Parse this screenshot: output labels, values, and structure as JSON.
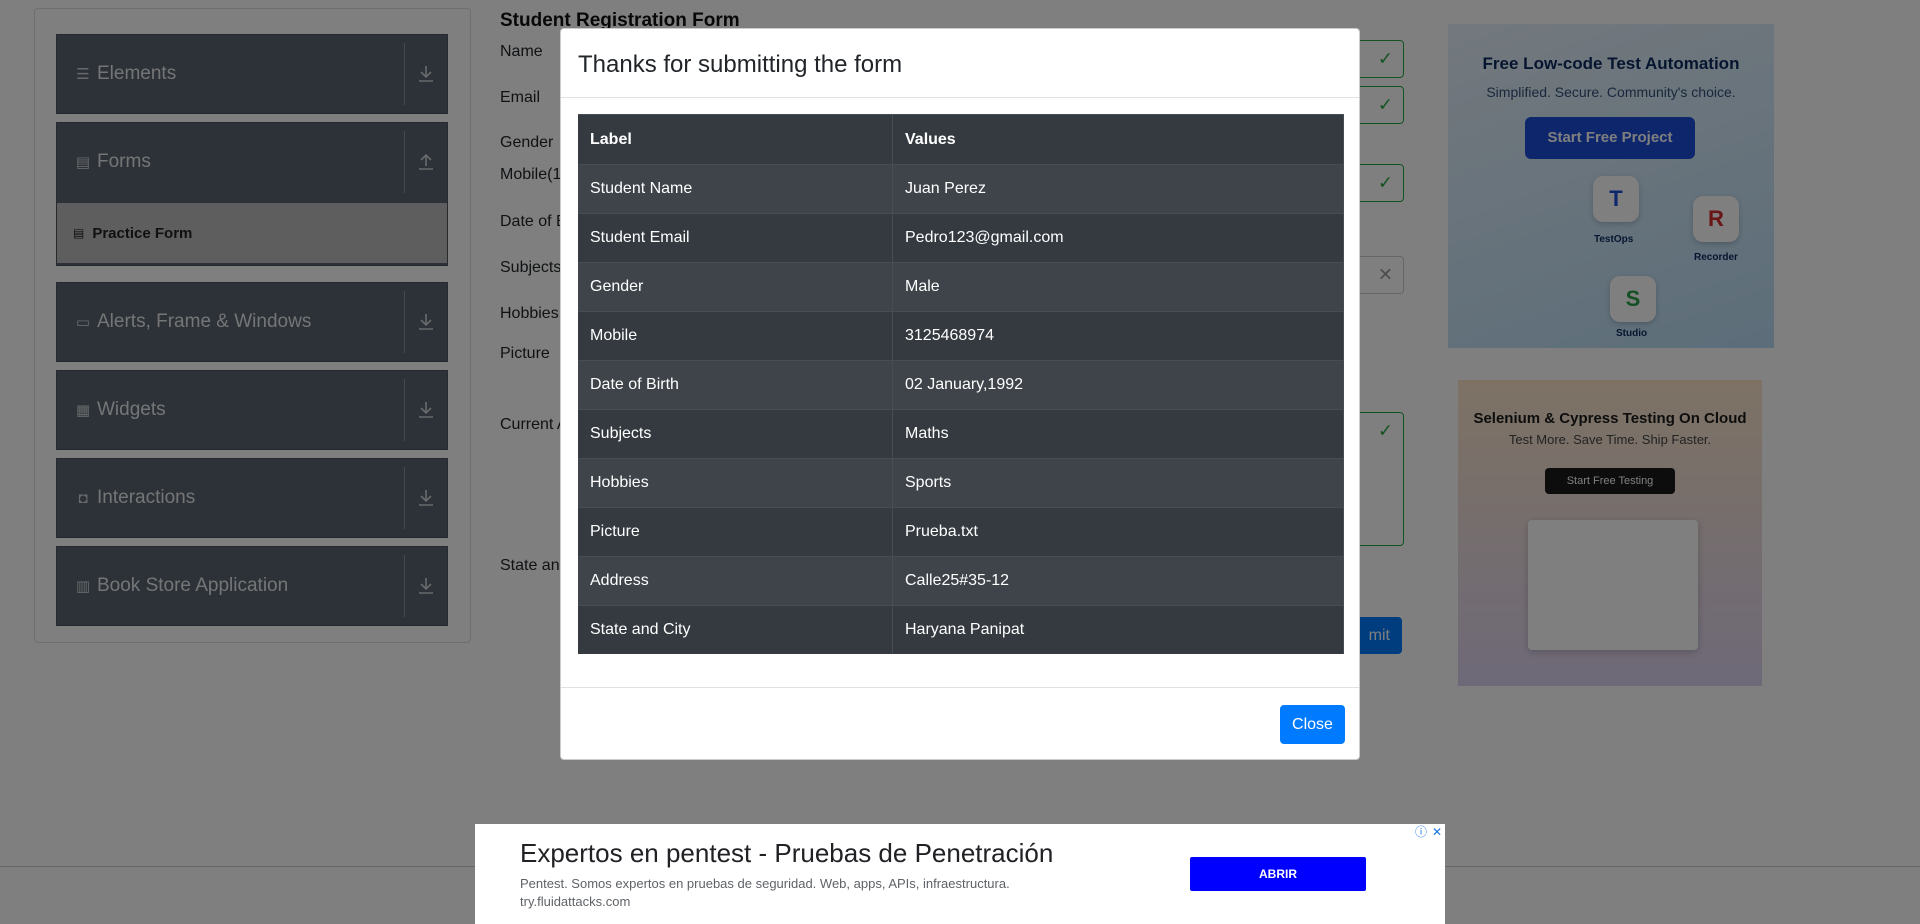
{
  "sidebar": {
    "groups": [
      {
        "label": "Elements",
        "icon": "hamburger-icon",
        "arrow": "download-icon"
      },
      {
        "label": "Forms",
        "icon": "document-icon",
        "arrow": "upload-icon"
      },
      {
        "label": "Alerts, Frame & Windows",
        "icon": "window-icon",
        "arrow": "download-icon"
      },
      {
        "label": "Widgets",
        "icon": "widgets-icon",
        "arrow": "download-icon"
      },
      {
        "label": "Interactions",
        "icon": "interaction-icon",
        "arrow": "download-icon"
      },
      {
        "label": "Book Store Application",
        "icon": "books-icon",
        "arrow": "download-icon"
      }
    ],
    "active_item": "Practice Form"
  },
  "form": {
    "title": "Student Registration Form",
    "labels": {
      "name": "Name",
      "email": "Email",
      "gender": "Gender",
      "mobile": "Mobile(1",
      "dob": "Date of B",
      "subjects": "Subjects",
      "hobbies": "Hobbies",
      "picture": "Picture",
      "address": "Current A",
      "state": "State and"
    },
    "submit_label": "mit"
  },
  "ads": {
    "ad1": {
      "title": "Free Low-code Test Automation",
      "subtitle": "Simplified. Secure. Community's choice.",
      "button": "Start Free Project",
      "tiles": [
        "TestOps",
        "Recorder",
        "Studio"
      ]
    },
    "ad2": {
      "title": "Selenium & Cypress Testing On Cloud",
      "subtitle": "Test More. Save Time. Ship Faster.",
      "button": "Start Free Testing"
    }
  },
  "modal": {
    "title": "Thanks for submitting the form",
    "headers": {
      "label": "Label",
      "values": "Values"
    },
    "rows": [
      {
        "label": "Student Name",
        "value": "Juan Perez"
      },
      {
        "label": "Student Email",
        "value": "Pedro123@gmail.com"
      },
      {
        "label": "Gender",
        "value": "Male"
      },
      {
        "label": "Mobile",
        "value": "3125468974"
      },
      {
        "label": "Date of Birth",
        "value": "02 January,1992"
      },
      {
        "label": "Subjects",
        "value": "Maths"
      },
      {
        "label": "Hobbies",
        "value": "Sports"
      },
      {
        "label": "Picture",
        "value": "Prueba.txt"
      },
      {
        "label": "Address",
        "value": "Calle25#35-12"
      },
      {
        "label": "State and City",
        "value": "Haryana Panipat"
      }
    ],
    "close_label": "Close"
  },
  "bottom_ad": {
    "headline": "Expertos en pentest - Pruebas de Penetración",
    "description": "Pentest. Somos expertos en pruebas de seguridad. Web, apps, APIs, infraestructura.",
    "url": "try.fluidattacks.com",
    "button": "ABRIR"
  },
  "colors": {
    "primary": "#007bff",
    "success": "#28a745",
    "sidebar_group": "#5a6470",
    "table_dark": "#343a40",
    "ad_button": "#0000ff"
  }
}
